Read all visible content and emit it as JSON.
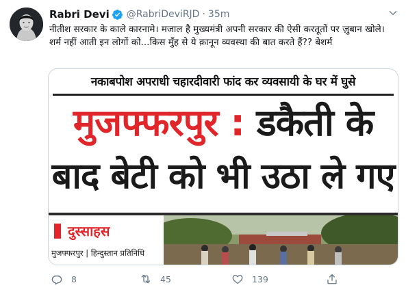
{
  "author": {
    "name": "Rabri Devi",
    "handle": "@RabriDeviRJD",
    "separator": "·",
    "time": "35m",
    "verified_icon": "verified-badge-icon"
  },
  "tweet": {
    "text": "नीतीश सरकार के काले कारनामे। मजाल है मुख्यमंत्री अपनी सरकार की ऐसी करतूतों पर ज़ुबान खोले। शर्म नहीं आती इन लोगों को...किस मुँह से ये क़ानून व्यवस्था की बात करते हैं?? बेशर्म"
  },
  "media": {
    "kicker": "नकाबपोश अपराधी चहारदीवारी फांद कर व्यवसायी के घर में घुसे",
    "headline_place": "मुजफ्फरपुर",
    "headline_sep": ":",
    "headline_rest": "डकैती के",
    "headline_line2": "बाद बेटी को भी उठा ले गए",
    "section_label": "दुस्साहस",
    "byline": "मुजफ्फरपुर | हिन्दुस्तान प्रतिनिधि"
  },
  "actions": {
    "reply_count": "8",
    "retweet_count": "45",
    "like_count": "139"
  },
  "colors": {
    "accent": "#1da1f2",
    "headline_red": "#e0262a",
    "muted": "#657786"
  }
}
